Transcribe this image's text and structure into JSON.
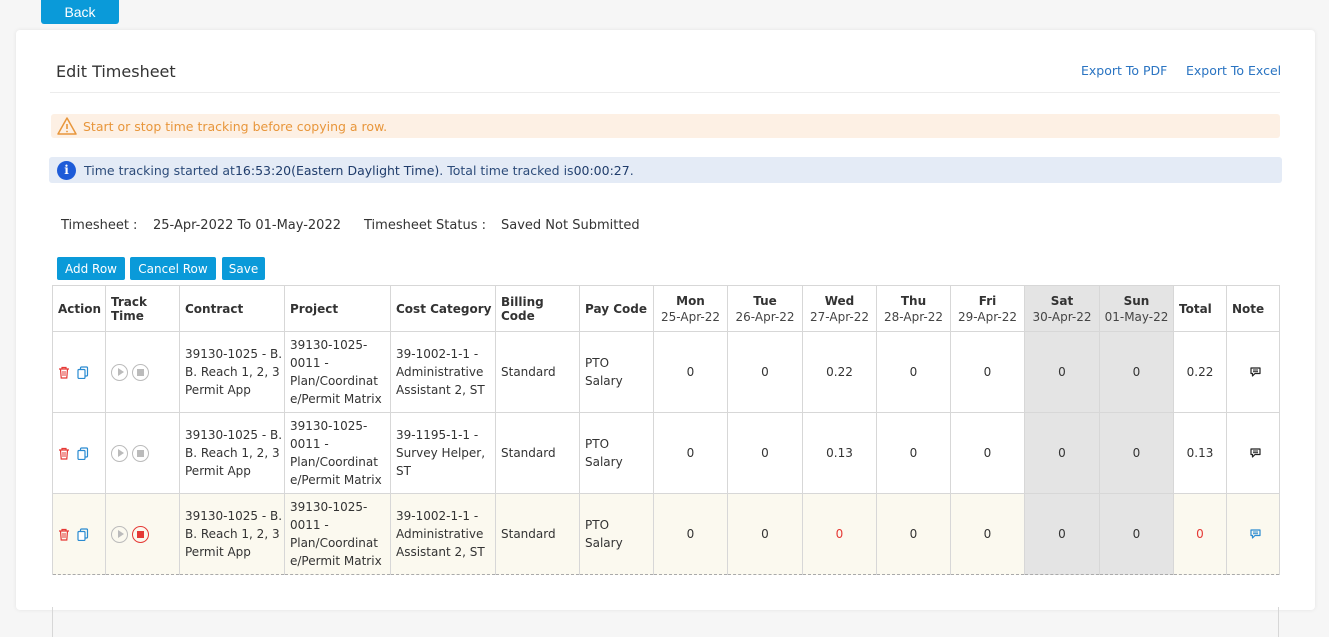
{
  "back_label": "Back",
  "title": "Edit Timesheet",
  "export_pdf": "Export To PDF",
  "export_excel": "Export To Excel",
  "warning": "Start or stop time tracking before copying a row.",
  "info": {
    "prefix": "Time tracking started at ",
    "start": "16:53:20(Eastern Daylight Time)",
    "mid": ". Total time tracked is ",
    "total": "00:00:27",
    "suffix": "."
  },
  "meta": {
    "timesheet_label": "Timesheet :",
    "timesheet_value": "25-Apr-2022 To 01-May-2022",
    "status_label": "Timesheet Status :",
    "status_value": "Saved Not Submitted"
  },
  "buttons": {
    "add_row": "Add Row",
    "cancel_row": "Cancel Row",
    "save": "Save"
  },
  "columns": {
    "action": "Action",
    "track": "Track Time",
    "contract": "Contract",
    "project": "Project",
    "cost": "Cost Category",
    "billing": "Billing Code",
    "pay": "Pay Code",
    "total": "Total",
    "note": "Note"
  },
  "days": [
    {
      "name": "Mon",
      "date": "25-Apr-22"
    },
    {
      "name": "Tue",
      "date": "26-Apr-22"
    },
    {
      "name": "Wed",
      "date": "27-Apr-22"
    },
    {
      "name": "Thu",
      "date": "28-Apr-22"
    },
    {
      "name": "Fri",
      "date": "29-Apr-22"
    },
    {
      "name": "Sat",
      "date": "30-Apr-22"
    },
    {
      "name": "Sun",
      "date": "01-May-22"
    }
  ],
  "rows": [
    {
      "contract": [
        "39130-1025 - B.",
        "B. Reach 1, 2, 3",
        "Permit App"
      ],
      "project": [
        "39130-1025-",
        "0011 -",
        "Plan/Coordinat",
        "e/Permit Matrix"
      ],
      "cost": [
        "39-1002-1-1 -",
        "Administrative",
        "Assistant 2, ST"
      ],
      "billing": "Standard",
      "pay": [
        "PTO",
        "Salary"
      ],
      "hours": [
        "0",
        "0",
        "0.22",
        "0",
        "0",
        "0",
        "0"
      ],
      "total": "0.22"
    },
    {
      "contract": [
        "39130-1025 - B.",
        "B. Reach 1, 2, 3",
        "Permit App"
      ],
      "project": [
        "39130-1025-",
        "0011 -",
        "Plan/Coordinat",
        "e/Permit Matrix"
      ],
      "cost": [
        "39-1195-1-1 -",
        "Survey Helper,",
        "ST"
      ],
      "billing": "Standard",
      "pay": [
        "PTO",
        "Salary"
      ],
      "hours": [
        "0",
        "0",
        "0.13",
        "0",
        "0",
        "0",
        "0"
      ],
      "total": "0.13"
    },
    {
      "contract": [
        "39130-1025 - B.",
        "B. Reach 1, 2, 3",
        "Permit App"
      ],
      "project": [
        "39130-1025-",
        "0011 -",
        "Plan/Coordinat",
        "e/Permit Matrix"
      ],
      "cost": [
        "39-1002-1-1 -",
        "Administrative",
        "Assistant 2, ST"
      ],
      "billing": "Standard",
      "pay": [
        "PTO",
        "Salary"
      ],
      "hours": [
        "0",
        "0",
        "0",
        "0",
        "0",
        "0",
        "0"
      ],
      "total": "0"
    }
  ],
  "colors": {
    "accent": "#0a9ad9",
    "link": "#2a74c2",
    "warning_text": "#e8963b",
    "warning_bg": "#fdf0e4",
    "info_bg": "#e4ebf6",
    "tracking_red": "#e53935"
  },
  "icons": {
    "delete": "trash-icon",
    "copy": "copy-icon",
    "play": "play-icon",
    "stop": "stop-icon",
    "note": "comment-icon",
    "warning": "warning-triangle-icon",
    "info": "info-icon"
  }
}
